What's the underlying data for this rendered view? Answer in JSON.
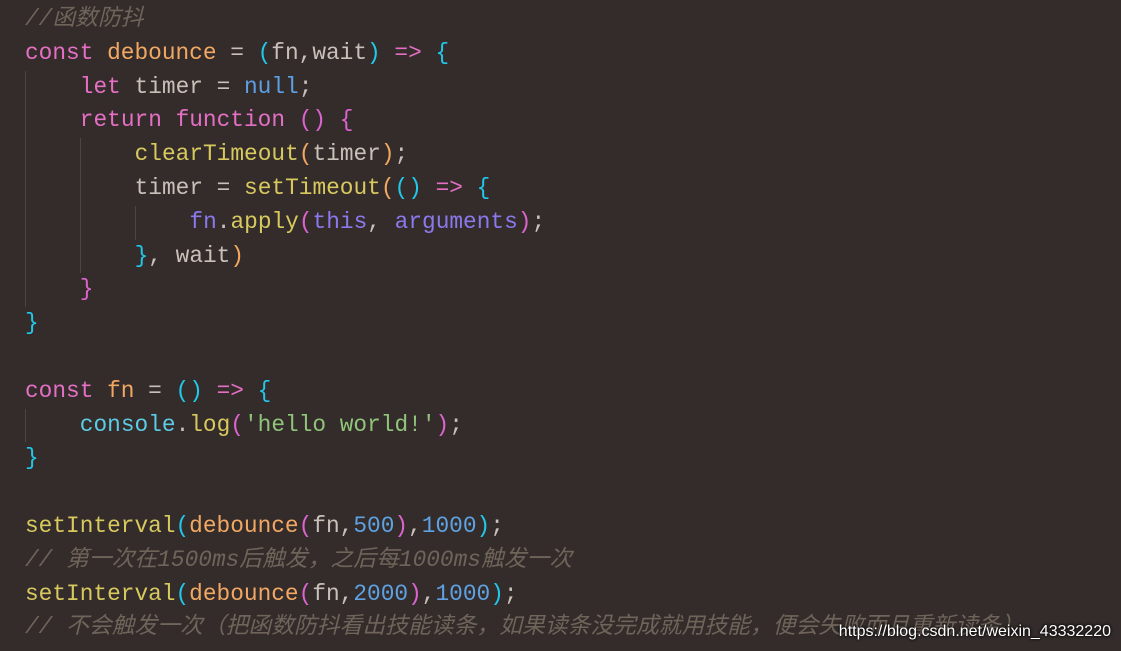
{
  "code": {
    "lines": [
      {
        "indent": 0,
        "tokens": [
          [
            "//函数防抖",
            "c"
          ]
        ]
      },
      {
        "indent": 0,
        "tokens": [
          [
            "const ",
            "k"
          ],
          [
            "debounce",
            "fnname"
          ],
          [
            " = ",
            "p"
          ],
          [
            "(",
            "b1"
          ],
          [
            "fn,wait",
            "p"
          ],
          [
            ")",
            "b1"
          ],
          [
            " => ",
            "k"
          ],
          [
            "{",
            "b1"
          ]
        ]
      },
      {
        "indent": 1,
        "tokens": [
          [
            "let ",
            "k"
          ],
          [
            "timer = ",
            "p"
          ],
          [
            "null",
            "nul"
          ],
          [
            ";",
            "p"
          ]
        ]
      },
      {
        "indent": 1,
        "tokens": [
          [
            "return ",
            "k"
          ],
          [
            "function ",
            "k"
          ],
          [
            "()",
            "b2"
          ],
          [
            " ",
            "p"
          ],
          [
            "{",
            "b2"
          ]
        ]
      },
      {
        "indent": 2,
        "tokens": [
          [
            "clearTimeout",
            "y"
          ],
          [
            "(",
            "b3"
          ],
          [
            "timer",
            "p"
          ],
          [
            ")",
            "b3"
          ],
          [
            ";",
            "p"
          ]
        ]
      },
      {
        "indent": 2,
        "tokens": [
          [
            "timer = ",
            "p"
          ],
          [
            "setTimeout",
            "y"
          ],
          [
            "(",
            "b3"
          ],
          [
            "()",
            "b1"
          ],
          [
            " => ",
            "k"
          ],
          [
            "{",
            "b1"
          ]
        ]
      },
      {
        "indent": 3,
        "tokens": [
          [
            "fn",
            "pu"
          ],
          [
            ".",
            "p"
          ],
          [
            "apply",
            "y"
          ],
          [
            "(",
            "b2"
          ],
          [
            "this",
            "pu"
          ],
          [
            ", ",
            "p"
          ],
          [
            "arguments",
            "pu"
          ],
          [
            ")",
            "b2"
          ],
          [
            ";",
            "p"
          ]
        ]
      },
      {
        "indent": 2,
        "tokens": [
          [
            "}",
            "b1"
          ],
          [
            ", wait",
            "p"
          ],
          [
            ")",
            "b3"
          ]
        ]
      },
      {
        "indent": 1,
        "tokens": [
          [
            "}",
            "b2"
          ]
        ]
      },
      {
        "indent": 0,
        "tokens": [
          [
            "}",
            "b1"
          ]
        ]
      },
      {
        "indent": 0,
        "tokens": []
      },
      {
        "indent": 0,
        "tokens": [
          [
            "const ",
            "k"
          ],
          [
            "fn",
            "fnname"
          ],
          [
            " = ",
            "p"
          ],
          [
            "()",
            "b1"
          ],
          [
            " => ",
            "k"
          ],
          [
            "{",
            "b1"
          ]
        ]
      },
      {
        "indent": 1,
        "tokens": [
          [
            "console",
            "cy"
          ],
          [
            ".",
            "p"
          ],
          [
            "log",
            "y"
          ],
          [
            "(",
            "b2"
          ],
          [
            "'hello world!'",
            "s"
          ],
          [
            ")",
            "b2"
          ],
          [
            ";",
            "p"
          ]
        ]
      },
      {
        "indent": 0,
        "tokens": [
          [
            "}",
            "b1"
          ]
        ]
      },
      {
        "indent": 0,
        "tokens": []
      },
      {
        "indent": 0,
        "tokens": [
          [
            "setInterval",
            "y"
          ],
          [
            "(",
            "b1"
          ],
          [
            "debounce",
            "fnname"
          ],
          [
            "(",
            "b2"
          ],
          [
            "fn,",
            "p"
          ],
          [
            "500",
            "n"
          ],
          [
            ")",
            "b2"
          ],
          [
            ",",
            "p"
          ],
          [
            "1000",
            "n"
          ],
          [
            ")",
            "b1"
          ],
          [
            ";",
            "p"
          ]
        ]
      },
      {
        "indent": 0,
        "tokens": [
          [
            "// 第一次在1500ms后触发，之后每1000ms触发一次",
            "c"
          ]
        ]
      },
      {
        "indent": 0,
        "tokens": [
          [
            "setInterval",
            "y"
          ],
          [
            "(",
            "b1"
          ],
          [
            "debounce",
            "fnname"
          ],
          [
            "(",
            "b2"
          ],
          [
            "fn,",
            "p"
          ],
          [
            "2000",
            "n"
          ],
          [
            ")",
            "b2"
          ],
          [
            ",",
            "p"
          ],
          [
            "1000",
            "n"
          ],
          [
            ")",
            "b1"
          ],
          [
            ";",
            "p"
          ]
        ]
      },
      {
        "indent": 0,
        "tokens": [
          [
            "// 不会触发一次（把函数防抖看出技能读条，如果读条没完成就用技能，便会失败而且重新读条）",
            "c"
          ]
        ]
      }
    ],
    "guides": [
      [],
      [],
      [
        0
      ],
      [
        0
      ],
      [
        0,
        1
      ],
      [
        0,
        1
      ],
      [
        0,
        1,
        2
      ],
      [
        0,
        1
      ],
      [
        0
      ],
      [],
      [],
      [],
      [
        0
      ],
      [],
      [],
      [],
      [],
      [],
      []
    ]
  },
  "watermark": "https://blog.csdn.net/weixin_43332220"
}
